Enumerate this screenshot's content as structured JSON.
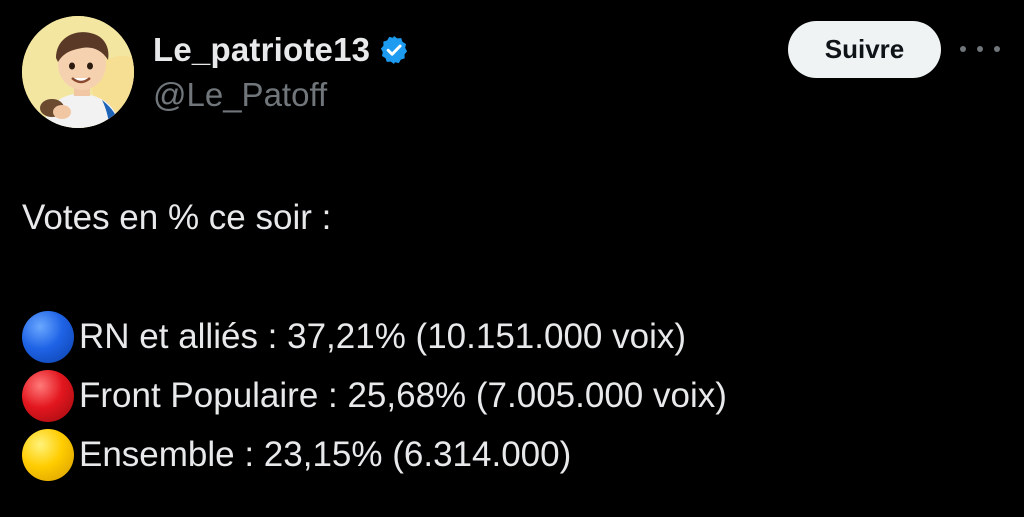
{
  "author": {
    "display_name": "Le_patriote13",
    "handle": "@Le_Patoff",
    "verified_icon": "verified-badge-icon",
    "verified_color": "#1d9bf0"
  },
  "actions": {
    "follow_label": "Suivre",
    "more_icon": "more-horizontal-icon"
  },
  "tweet": {
    "intro": "Votes en % ce soir :",
    "results": [
      {
        "icon": "blue-circle-icon",
        "color": "#1f63e6",
        "text": "RN et alliés : 37,21% (10.151.000 voix)"
      },
      {
        "icon": "red-circle-icon",
        "color": "#e3161e",
        "text": "Front Populaire : 25,68% (7.005.000 voix)"
      },
      {
        "icon": "yellow-circle-icon",
        "color": "#ffcc00",
        "text": "Ensemble : 23,15% (6.314.000)"
      }
    ]
  }
}
